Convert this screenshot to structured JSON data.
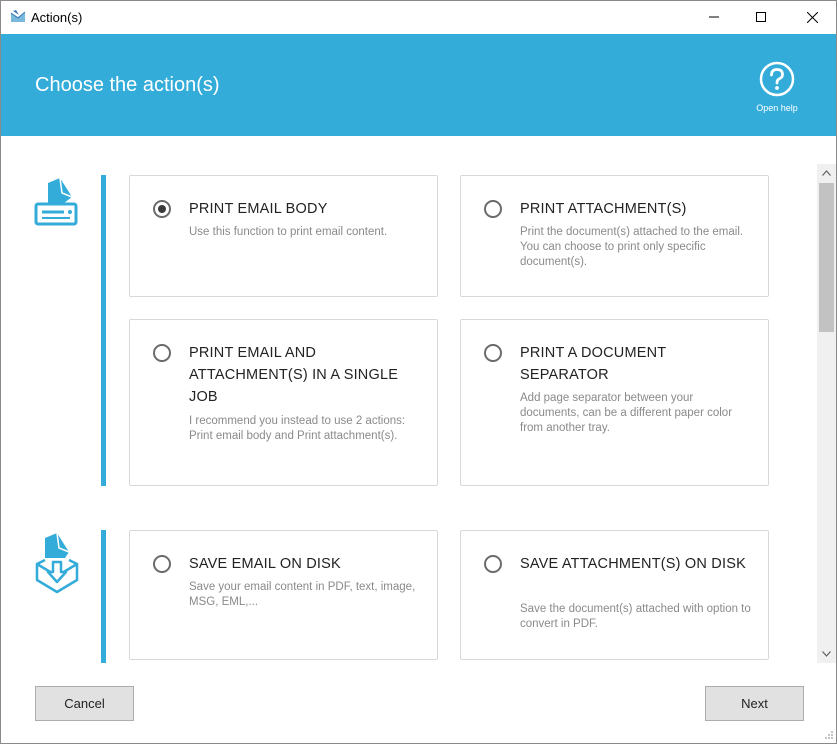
{
  "window": {
    "title": "Action(s)"
  },
  "header": {
    "title": "Choose the action(s)",
    "help_label": "Open help"
  },
  "groups": [
    {
      "name": "print",
      "icon": "printer-icon"
    },
    {
      "name": "save",
      "icon": "save-to-disk-icon"
    }
  ],
  "options": [
    {
      "title": "PRINT EMAIL BODY",
      "description": "Use this function to print email content.",
      "selected": true
    },
    {
      "title": "PRINT ATTACHMENT(S)",
      "description": "Print the document(s) attached to the email. You can choose to print only specific document(s).",
      "selected": false
    },
    {
      "title": "PRINT EMAIL AND ATTACHMENT(S) IN A SINGLE JOB",
      "description": "I recommend you instead to use 2 actions: Print email body and Print attachment(s).",
      "selected": false
    },
    {
      "title": "PRINT A DOCUMENT SEPARATOR",
      "description": "Add page separator between your documents, can be a different paper color from another tray.",
      "selected": false
    },
    {
      "title": "SAVE EMAIL ON DISK",
      "description": "Save your email content in PDF, text, image, MSG, EML,...",
      "selected": false
    },
    {
      "title": "SAVE ATTACHMENT(S) ON DISK",
      "description": "Save the document(s) attached with option to convert in PDF.",
      "selected": false
    }
  ],
  "footer": {
    "cancel_label": "Cancel",
    "next_label": "Next"
  },
  "colors": {
    "accent": "#33acd9",
    "button_bg": "#e1e1e1"
  }
}
